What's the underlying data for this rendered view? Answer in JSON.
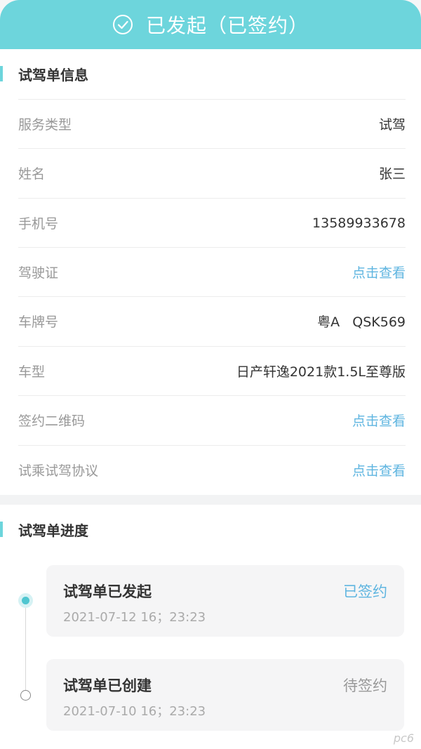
{
  "header": {
    "title": "已发起（已签约）",
    "bg_color": "#6dd5dc"
  },
  "info_section": {
    "title": "试驾单信息",
    "rows": [
      {
        "label": "服务类型",
        "value": "试驾",
        "is_link": false
      },
      {
        "label": "姓名",
        "value": "张三",
        "is_link": false
      },
      {
        "label": "手机号",
        "value": "13589933678",
        "is_link": false
      },
      {
        "label": "驾驶证",
        "value": "点击查看",
        "is_link": true
      },
      {
        "label": "车牌号",
        "value": "粤A   QSK569",
        "is_link": false
      },
      {
        "label": "车型",
        "value": "日产轩逸2021款1.5L至尊版",
        "is_link": false
      },
      {
        "label": "签约二维码",
        "value": "点击查看",
        "is_link": true
      },
      {
        "label": "试乘试驾协议",
        "value": "点击查看",
        "is_link": true
      }
    ]
  },
  "progress_section": {
    "title": "试驾单进度",
    "items": [
      {
        "title": "试驾单已发起",
        "time": "2021-07-12 16；23:23",
        "status": "已签约",
        "active": true
      },
      {
        "title": "试驾单已创建",
        "time": "2021-07-10 16；23:23",
        "status": "待签约",
        "active": false
      }
    ]
  },
  "watermark": "pc6",
  "colors": {
    "accent": "#6dd5dc",
    "link": "#5fb5e0",
    "label": "#999999",
    "value": "#333333"
  }
}
